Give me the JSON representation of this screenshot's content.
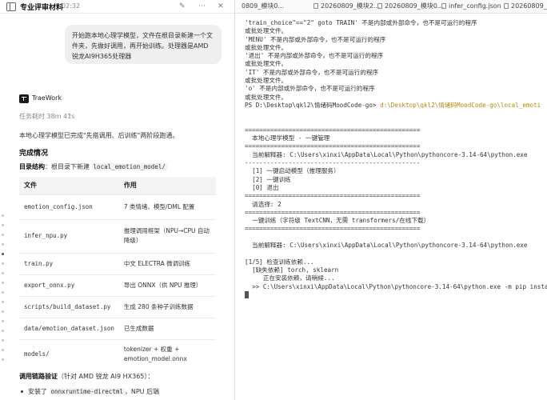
{
  "left": {
    "header": {
      "title": "专业评审材料",
      "time": "02:32"
    },
    "user_message": "开始跑本地心理学模型，文件在根目录新建一个文件夹，先做好调用，再开始训练。处理器是AMD锐龙AI9H365处理器",
    "agent": {
      "name": "TraeWork",
      "task_time": "任务耗时 38m 41s",
      "summary": "本地心理学模型已完成\"先搭调用、后训练\"两阶段跑通。",
      "section_title": "完成情况",
      "structure_label": "目录结构",
      "structure_text": "：根目录下新建",
      "structure_code": "local_emotion_model/",
      "table": {
        "headers": [
          "文件",
          "作用"
        ],
        "rows": [
          {
            "file": "emotion_config.json",
            "desc": "7 类情绪、模型/DML 配置"
          },
          {
            "file": "infer_npu.py",
            "desc": "推理调用框架（NPU→CPU 自动降级）"
          },
          {
            "file": "train.py",
            "desc": "中文 ELECTRA 微调训练"
          },
          {
            "file": "export_onnx.py",
            "desc": "导出 ONNX（供 NPU 推理）"
          },
          {
            "file": "scripts/build_dataset.py",
            "desc": "生成 280 条种子训练数据"
          },
          {
            "file": "data/emotion_dataset.json",
            "desc": "已生成数据"
          },
          {
            "file": "models/",
            "desc": "tokenizer + 权重 + emotion_model.onnx"
          }
        ]
      },
      "verify_label": "调用链路验证",
      "verify_text": "（针对 AMD 锐龙 AI9 HX365）：",
      "bullet_prefix": "安装了",
      "bullet_code": "onnxruntime-directml",
      "bullet_suffix": "，NPU 后端"
    }
  },
  "right": {
    "tabs": [
      {
        "label": "0809_模块0..."
      },
      {
        "label": "20260809_模块2..."
      },
      {
        "label": "20260809_模块0..."
      },
      {
        "label": "infer_config.json"
      },
      {
        "label": "20260809_模块..."
      }
    ],
    "terminal_lines": [
      "'train_choice\"==\"2\" goto TRAIN' 不是内部或外部命令，也不是可运行的程序",
      "或批处理文件。",
      "'MENU' 不是内部或外部命令，也不是可运行的程序",
      "或批处理文件。",
      "'退出' 不是内部或外部命令，也不是可运行的程序",
      "或批处理文件。",
      "'IT' 不是内部或外部命令，也不是可运行的程序",
      "或批处理文件。",
      "'o' 不是内部或外部命令，也不是可运行的程序",
      "或批处理文件。",
      "",
      "",
      "================================================",
      "  本地心理学模型 - 一键管理",
      "================================================",
      "  当前解释器: C:\\Users\\xinxi\\AppData\\Local\\Python\\pythoncore-3.14-64\\python.exe",
      "------------------------------------------------",
      "  [1] 一键启动模型（推理服务）",
      "  [2] 一键训练",
      "  [0] 退出",
      "================================================",
      "  请选择: 2",
      "================================================",
      "  一键训练（字符级 TextCNN，无需 transformers/在线下载）",
      "================================================",
      "",
      "  当前解释器: C:\\Users\\xinxi\\AppData\\Local\\Python\\pythoncore-3.14-64\\python.exe",
      "",
      "[1/5] 检查训练依赖...",
      "  [缺失依赖] torch, sklearn",
      "     正在安装依赖，请稍候...",
      "  >> C:\\Users\\xinxi\\AppData\\Local\\Python\\pythoncore-3.14-64\\python.exe -m pip insta"
    ],
    "prompt_prefix": "PS D:\\Desktop\\qkl2\\情绪码MoodCode-go> ",
    "prompt_command": "d:\\Desktop\\qkl2\\情绪码MoodCode-go\\local_emoti"
  }
}
